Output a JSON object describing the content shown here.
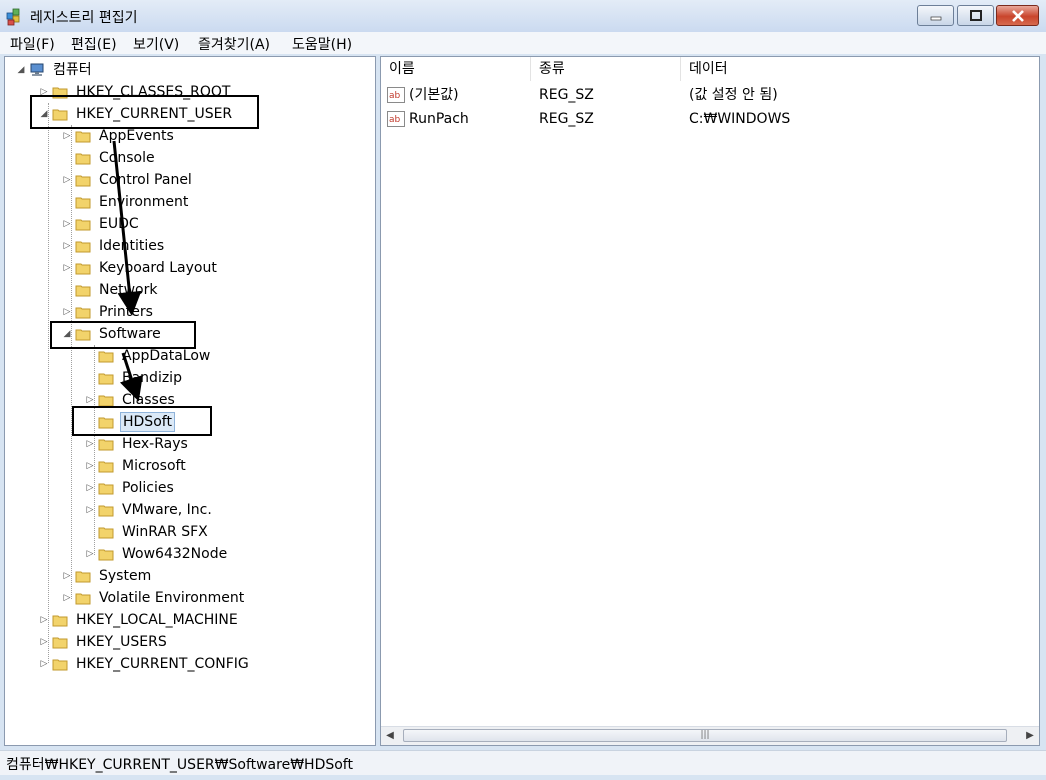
{
  "window": {
    "title": "레지스트리 편집기",
    "accent": "#d7e4f2"
  },
  "menu": [
    "파일(F)",
    "편집(E)",
    "보기(V)",
    "즐겨찾기(A)",
    "도움말(H)"
  ],
  "tree": {
    "root": "컴퓨터",
    "nodes": [
      "HKEY_CLASSES_ROOT",
      "HKEY_CURRENT_USER",
      "AppEvents",
      "Console",
      "Control Panel",
      "Environment",
      "EUDC",
      "Identities",
      "Keyboard Layout",
      "Network",
      "Printers",
      "Software",
      "AppDataLow",
      "Bandizip",
      "Classes",
      "HDSoft",
      "Hex-Rays",
      "Microsoft",
      "Policies",
      "VMware, Inc.",
      "WinRAR SFX",
      "Wow6432Node",
      "System",
      "Volatile Environment",
      "HKEY_LOCAL_MACHINE",
      "HKEY_USERS",
      "HKEY_CURRENT_CONFIG"
    ],
    "selected": "HDSoft"
  },
  "list": {
    "columns": [
      "이름",
      "종류",
      "데이터"
    ],
    "rows": [
      {
        "name": "(기본값)",
        "type": "REG_SZ",
        "data": "(값 설정 안 됨)"
      },
      {
        "name": "RunPach",
        "type": "REG_SZ",
        "data": "C:₩WINDOWS"
      }
    ]
  },
  "status": {
    "path": "컴퓨터₩HKEY_CURRENT_USER₩Software₩HDSoft"
  }
}
